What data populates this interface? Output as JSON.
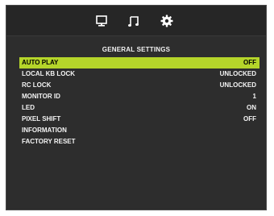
{
  "colors": {
    "panel_background": "#2d2d2d",
    "topbar_background": "#262626",
    "selection_highlight": "#b5d52a",
    "text": "#ffffff"
  },
  "tabs": [
    {
      "icon": "monitor-icon"
    },
    {
      "icon": "music-note-icon"
    },
    {
      "icon": "gear-icon",
      "active": true
    }
  ],
  "menu": {
    "title": "GENERAL SETTINGS",
    "items": [
      {
        "label": "AUTO PLAY",
        "value": "OFF",
        "selected": true
      },
      {
        "label": "LOCAL KB LOCK",
        "value": "UNLOCKED"
      },
      {
        "label": "RC LOCK",
        "value": "UNLOCKED"
      },
      {
        "label": "MONITOR ID",
        "value": "1"
      },
      {
        "label": "LED",
        "value": "ON"
      },
      {
        "label": "PIXEL SHIFT",
        "value": "OFF"
      },
      {
        "label": "INFORMATION",
        "value": ""
      },
      {
        "label": "FACTORY RESET",
        "value": ""
      }
    ]
  }
}
